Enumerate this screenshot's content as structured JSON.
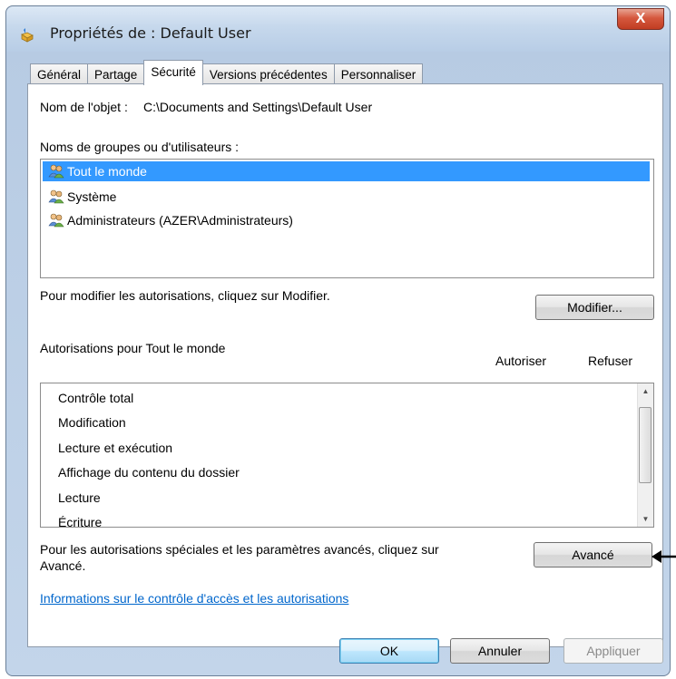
{
  "window": {
    "title": "Propriétés de : Default User",
    "close_label": "X"
  },
  "tabs": [
    "Général",
    "Partage",
    "Sécurité",
    "Versions précédentes",
    "Personnaliser"
  ],
  "active_tab": "Sécurité",
  "object": {
    "label": "Nom de l'objet :",
    "value": "C:\\Documents and Settings\\Default User"
  },
  "groups": {
    "label": "Noms de groupes ou d'utilisateurs :",
    "items": [
      {
        "name": "Tout le monde",
        "selected": true,
        "icon": "users-icon"
      },
      {
        "name": "Système",
        "selected": false,
        "icon": "users-icon"
      },
      {
        "name": "Administrateurs (AZER\\Administrateurs)",
        "selected": false,
        "icon": "users-icon"
      }
    ]
  },
  "modify": {
    "hint": "Pour modifier les autorisations, cliquez sur Modifier.",
    "button": "Modifier..."
  },
  "permissions": {
    "label": "Autorisations pour Tout le monde",
    "col_allow": "Autoriser",
    "col_deny": "Refuser",
    "items": [
      "Contrôle total",
      "Modification",
      "Lecture et exécution",
      "Affichage du contenu du dossier",
      "Lecture",
      "Écriture"
    ]
  },
  "advanced": {
    "hint_line1": "Pour les autorisations spéciales et les paramètres avancés, cliquez sur",
    "hint_line2": "Avancé.",
    "button": "Avancé"
  },
  "link": "Informations sur le contrôle d'accès et les autorisations",
  "footer": {
    "ok": "OK",
    "cancel": "Annuler",
    "apply": "Appliquer"
  },
  "colors": {
    "selection": "#3399ff",
    "link": "#0066cc",
    "close_button": "#c13d22"
  }
}
